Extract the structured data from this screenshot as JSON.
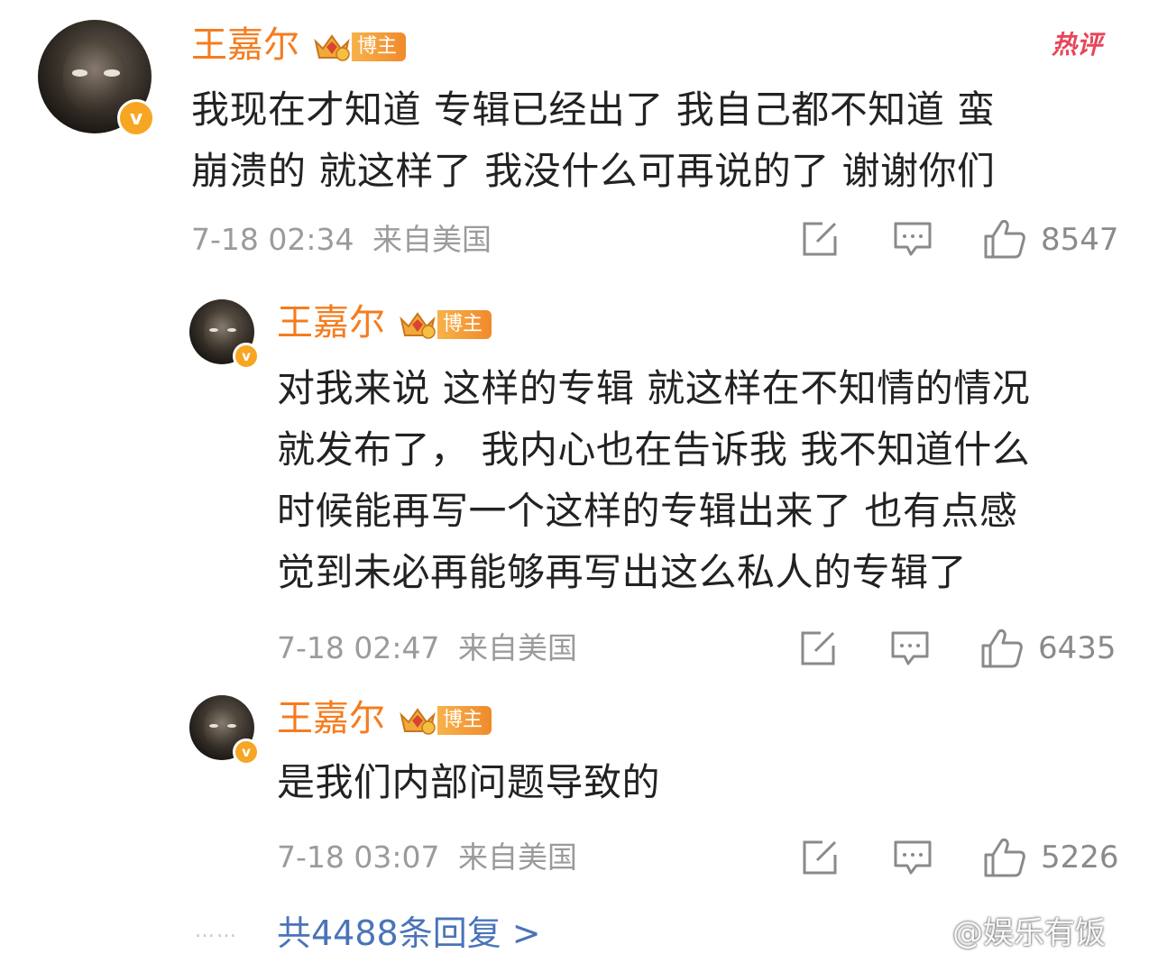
{
  "header": {
    "hot_label": "热评"
  },
  "comments": [
    {
      "author": "王嘉尔",
      "tag": "博主",
      "verified_glyph": "v",
      "text_lines": [
        "我现在才知道 专辑已经出了 我自己都不知道 蛮",
        "崩溃的  就这样了 我没什么可再说的了  谢谢你们"
      ],
      "time": "7-18 02:34",
      "location": "来自美国",
      "likes": "8547"
    },
    {
      "author": "王嘉尔",
      "tag": "博主",
      "verified_glyph": "v",
      "text_lines": [
        "对我来说 这样的专辑 就这样在不知情的情况",
        "就发布了，  我内心也在告诉我 我不知道什么",
        "时候能再写一个这样的专辑出来了 也有点感",
        "觉到未必再能够再写出这么私人的专辑了"
      ],
      "time": "7-18 02:47",
      "location": "来自美国",
      "likes": "6435"
    },
    {
      "author": "王嘉尔",
      "tag": "博主",
      "verified_glyph": "v",
      "text_lines": [
        "是我们内部问题导致的"
      ],
      "time": "7-18 03:07",
      "location": "来自美国",
      "likes": "5226"
    }
  ],
  "footer": {
    "dots": "……",
    "more_replies": "共4488条回复 >",
    "watermark": "@娱乐有饭"
  },
  "icons": {
    "share": "share-edit-icon",
    "comment": "comment-bubble-icon",
    "like": "thumbs-up-icon",
    "brand_color": "#f57c1f",
    "link_color": "#4a74b8"
  }
}
